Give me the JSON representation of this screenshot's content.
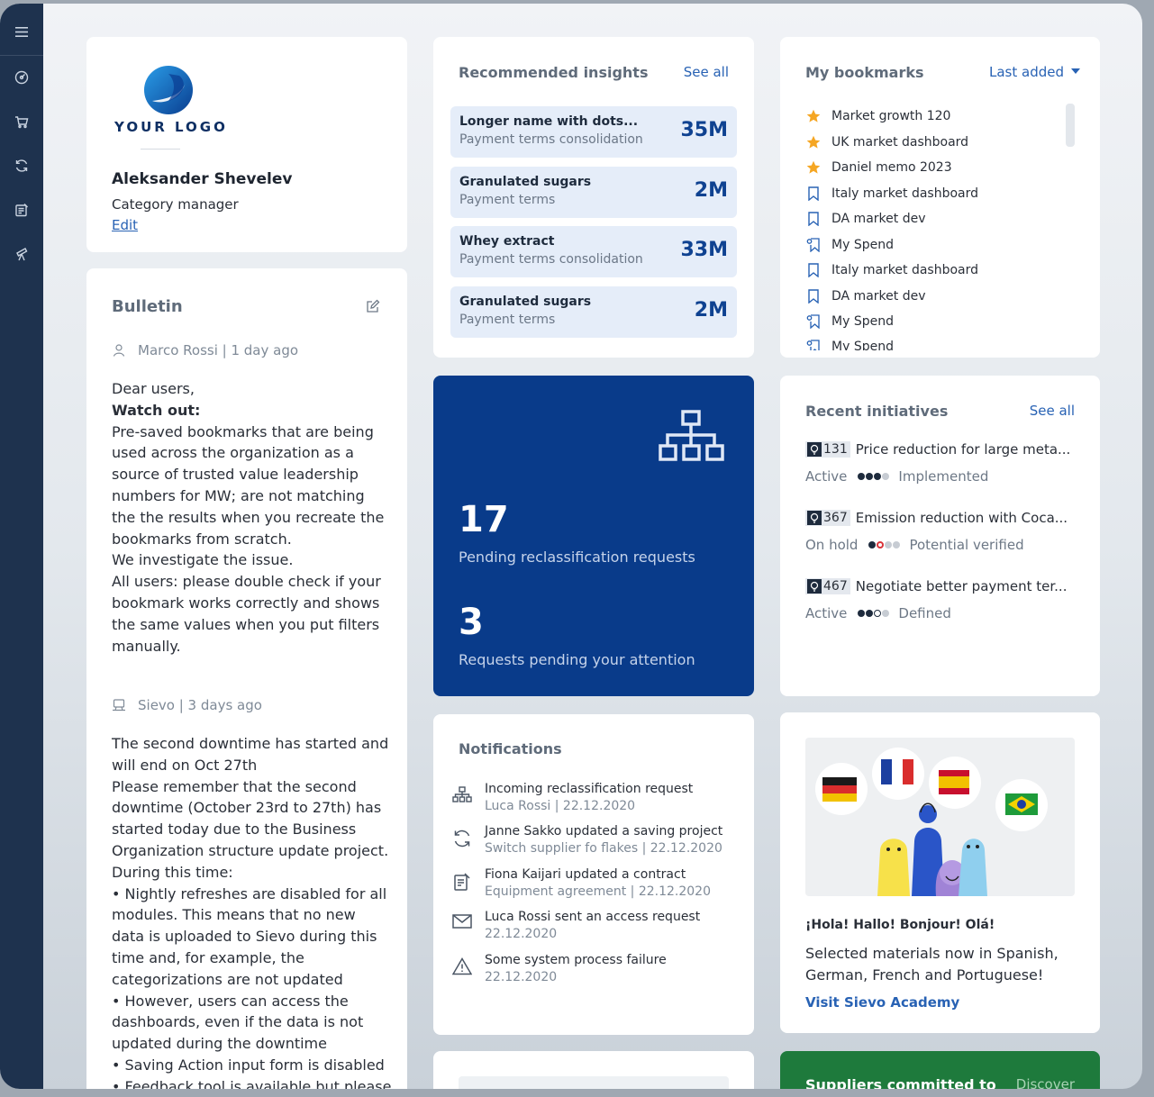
{
  "profile": {
    "logo_text": "YOUR LOGO",
    "name": "Aleksander Shevelev",
    "role": "Category manager",
    "edit": "Edit"
  },
  "bulletin": {
    "title": "Bulletin",
    "posts": [
      {
        "author_meta": "Marco Rossi | 1 day ago",
        "lines": [
          "Dear users,",
          "Watch out:",
          "Pre-saved bookmarks that are being",
          "used across the organization as a",
          "source of trusted value leadership",
          "numbers for MW; are not matching",
          "the the results when you recreate the",
          "bookmarks from scratch.",
          "We investigate the issue.",
          "All users: please double check if your",
          "bookmark works correctly and shows",
          "the same values when you put filters",
          "manually."
        ]
      },
      {
        "author_meta": "Sievo | 3 days ago",
        "lines": [
          "The second downtime has started and",
          "will end on Oct 27th",
          "Please remember that the second",
          "downtime (October 23rd to 27th) has",
          "started today due to the Business",
          "Organization structure update project.",
          "During this time:",
          "• Nightly refreshes are disabled for all",
          "modules. This means that no new",
          "data is uploaded to Sievo during this",
          "time and, for example, the",
          "categorizations are not updated",
          "• However, users can access the",
          "dashboards, even if the data is not",
          "updated during the downtime",
          "• Saving Action input form is disabled",
          "• Feedback tool is available but please"
        ]
      }
    ]
  },
  "insights": {
    "title": "Recommended insights",
    "see_all": "See all",
    "items": [
      {
        "title": "Longer name with dots...",
        "subtitle": "Payment terms consolidation",
        "value": "35M"
      },
      {
        "title": "Granulated sugars",
        "subtitle": "Payment terms",
        "value": "2M"
      },
      {
        "title": "Whey extract",
        "subtitle": "Payment terms consolidation",
        "value": "33M"
      },
      {
        "title": "Granulated sugars",
        "subtitle": "Payment terms",
        "value": "2M"
      }
    ]
  },
  "reclass": {
    "count1": "17",
    "label1": "Pending reclassification requests",
    "count2": "3",
    "label2": "Requests pending your attention"
  },
  "notifications": {
    "title": "Notifications",
    "items": [
      {
        "icon": "hierarchy-icon",
        "text": "Incoming reclassification request",
        "meta": "Luca Rossi | 22.12.2020"
      },
      {
        "icon": "refresh-icon",
        "text": "Janne Sakko updated a saving project",
        "meta": "Switch supplier fo flakes | 22.12.2020"
      },
      {
        "icon": "contract-icon",
        "text": "Fiona Kaijari updated a contract",
        "meta": "Equipment agreement | 22.12.2020"
      },
      {
        "icon": "mail-icon",
        "text": "Luca Rossi sent an access request",
        "meta": "22.12.2020"
      },
      {
        "icon": "warning-icon",
        "text": "Some system process failure",
        "meta": "22.12.2020"
      }
    ]
  },
  "bookmarks": {
    "title": "My bookmarks",
    "sort": "Last added",
    "items": [
      {
        "icon": "star-icon",
        "label": "Market growth 120"
      },
      {
        "icon": "star-icon",
        "label": "UK market dashboard"
      },
      {
        "icon": "star-icon",
        "label": "Daniel memo 2023"
      },
      {
        "icon": "bookmark-icon",
        "label": "Italy market dashboard"
      },
      {
        "icon": "bookmark-icon",
        "label": "DA market dev"
      },
      {
        "icon": "shared-bookmark-icon",
        "label": "My Spend"
      },
      {
        "icon": "bookmark-icon",
        "label": "Italy market dashboard"
      },
      {
        "icon": "bookmark-icon",
        "label": "DA market dev"
      },
      {
        "icon": "shared-bookmark-icon",
        "label": "My Spend"
      },
      {
        "icon": "shared-bookmark-icon",
        "label": "My Spend"
      }
    ]
  },
  "initiatives": {
    "title": "Recent initiatives",
    "see_all": "See all",
    "items": [
      {
        "id": "131",
        "title": "Price reduction for large meta...",
        "status": "Active",
        "stage": "Implemented",
        "dots": [
          "#1e2b3d",
          "#1e2b3d",
          "#1e2b3d",
          "#c7ccd3"
        ]
      },
      {
        "id": "367",
        "title": "Emission reduction with Coca...",
        "status": "On hold",
        "stage": "Potential verified",
        "dots": [
          "#1e2b3d",
          "#d9343a",
          "#c7ccd3",
          "#c7ccd3"
        ]
      },
      {
        "id": "467",
        "title": "Negotiate better payment ter...",
        "status": "Active",
        "stage": "Defined",
        "dots": [
          "#1e2b3d",
          "#1e2b3d",
          "#c7ccd3",
          "#c7ccd3"
        ]
      }
    ]
  },
  "academy": {
    "greeting": "¡Hola! Hallo! Bonjour! Olá!",
    "text_line1": "Selected materials now in Spanish,",
    "text_line2": "German, French and Portuguese!",
    "link": "Visit Sievo Academy"
  },
  "suppliers": {
    "title": "Suppliers committed to",
    "link": "Discover"
  },
  "colors": {
    "sidebar": "#1e324e",
    "reclass_bg": "#093b8a",
    "accent": "#2862b4",
    "star": "#f5a623",
    "suppliers_bg": "#1e7a3c"
  }
}
